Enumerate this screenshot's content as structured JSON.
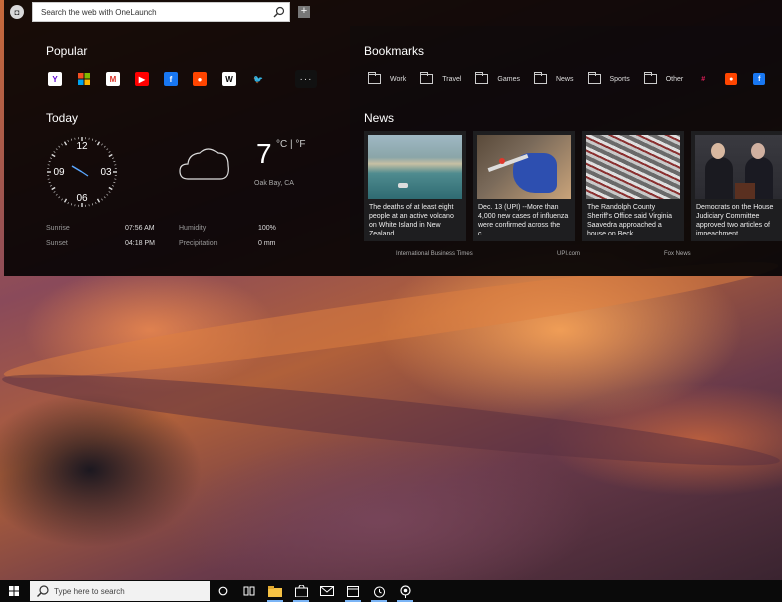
{
  "search": {
    "placeholder": "Search the web with OneLaunch"
  },
  "sections": {
    "popular": "Popular",
    "bookmarks": "Bookmarks",
    "today": "Today",
    "news": "News"
  },
  "popular_icons": [
    {
      "name": "yahoo-icon",
      "glyph": "Y",
      "color": "#ffffff",
      "fg": "#5f01d1"
    },
    {
      "name": "microsoft-icon",
      "glyph": "",
      "color": "#f25022",
      "fg": "#fff"
    },
    {
      "name": "gmail-icon",
      "glyph": "M",
      "color": "#ffffff",
      "fg": "#d93025"
    },
    {
      "name": "youtube-icon",
      "glyph": "▶",
      "color": "#ff0000",
      "fg": "#fff"
    },
    {
      "name": "facebook-icon",
      "glyph": "f",
      "color": "#1877f2",
      "fg": "#fff"
    },
    {
      "name": "reddit-icon",
      "glyph": "●",
      "color": "#ff4500",
      "fg": "#fff"
    },
    {
      "name": "wikipedia-icon",
      "glyph": "W",
      "color": "#ffffff",
      "fg": "#000"
    },
    {
      "name": "twitter-icon",
      "glyph": "🐦",
      "color": "transparent",
      "fg": "#1da1f2"
    }
  ],
  "more_label": "···",
  "bookmarks": [
    {
      "label": "Work"
    },
    {
      "label": "Travel"
    },
    {
      "label": "Games"
    },
    {
      "label": "News"
    },
    {
      "label": "Sports"
    },
    {
      "label": "Other"
    }
  ],
  "bookmark_social": [
    {
      "name": "slack-icon",
      "glyph": "#",
      "color": "transparent",
      "fg": "#e01e5a"
    },
    {
      "name": "reddit-icon",
      "glyph": "●",
      "color": "#ff4500",
      "fg": "#fff"
    },
    {
      "name": "facebook-icon",
      "glyph": "f",
      "color": "#1877f2",
      "fg": "#fff"
    }
  ],
  "clock": {
    "n12": "12",
    "n3": "03",
    "n6": "06",
    "n9": "09"
  },
  "weather": {
    "temp": "7",
    "units": "°C | °F",
    "location": "Oak Bay, CA",
    "sunrise_label": "Sunrise",
    "sunrise": "07:56 AM",
    "sunset_label": "Sunset",
    "sunset": "04:18 PM",
    "humidity_label": "Humidity",
    "humidity": "100%",
    "precip_label": "Precipitation",
    "precip": "0 mm"
  },
  "news": [
    {
      "text": "The deaths of at least eight people at an active volcano on White Island in New Zealand,",
      "source": "International Business Times"
    },
    {
      "text": "Dec. 13 (UPI) --More than 4,000 new cases of influenza were confirmed across the c...",
      "source": "UPI.com"
    },
    {
      "text": "The Randolph County Sheriff's Office said Virginia Saavedra approached a house on Beck...",
      "source": "Fox News"
    },
    {
      "text": "Democrats on the House Judiciary Committee approved two articles of impeachment",
      "source": ""
    }
  ],
  "taskbar": {
    "search_placeholder": "Type here to search"
  }
}
